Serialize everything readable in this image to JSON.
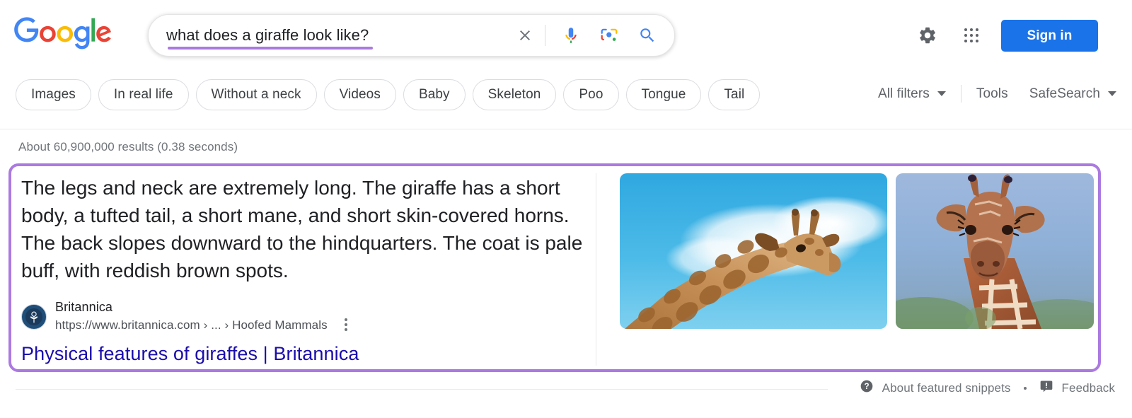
{
  "header": {
    "logo_alt": "Google",
    "logo_colors": {
      "blue": "#4285F4",
      "red": "#EA4335",
      "yellow": "#FBBC05",
      "green": "#34A853"
    },
    "search": {
      "value": "what does a giraffe look like?",
      "placeholder": "Search",
      "underline_color": "#ab7ae0",
      "clear_icon": "close-icon",
      "mic_icon": "microphone-icon",
      "lens_icon": "google-lens-icon",
      "search_icon": "search-icon"
    },
    "settings_icon": "gear-icon",
    "apps_icon": "google-apps-grid-icon",
    "signin_label": "Sign in",
    "signin_color": "#1a73e8"
  },
  "filters": {
    "chips": [
      {
        "label": "Images"
      },
      {
        "label": "In real life"
      },
      {
        "label": "Without a neck"
      },
      {
        "label": "Videos"
      },
      {
        "label": "Baby"
      },
      {
        "label": "Skeleton"
      },
      {
        "label": "Poo"
      },
      {
        "label": "Tongue"
      },
      {
        "label": "Tail"
      }
    ],
    "all_filters_label": "All filters",
    "tools_label": "Tools",
    "safesearch_label": "SafeSearch"
  },
  "results": {
    "stats": "About 60,900,000 results (0.38 seconds)"
  },
  "featured_snippet": {
    "highlight_color": "#ab7ae0",
    "text": "The legs and neck are extremely long. The giraffe has a short body, a tufted tail, a short mane, and short skin-covered horns. The back slopes downward to the hindquarters. The coat is pale buff, with reddish brown spots.",
    "source": {
      "favicon_alt": "britannica-favicon",
      "name": "Britannica",
      "url": "https://www.britannica.com › ... › Hoofed Mammals",
      "kebab_icon": "more-options-icon"
    },
    "title": "Physical features of giraffes | Britannica",
    "title_color": "#1a0dab",
    "images": [
      {
        "alt": "giraffe-head-and-neck-blue-sky-photo"
      },
      {
        "alt": "giraffe-face-front-view-photo"
      }
    ]
  },
  "footer": {
    "help_icon": "help-circle-icon",
    "about_label": "About featured snippets",
    "feedback_icon": "feedback-flag-icon",
    "feedback_label": "Feedback"
  }
}
